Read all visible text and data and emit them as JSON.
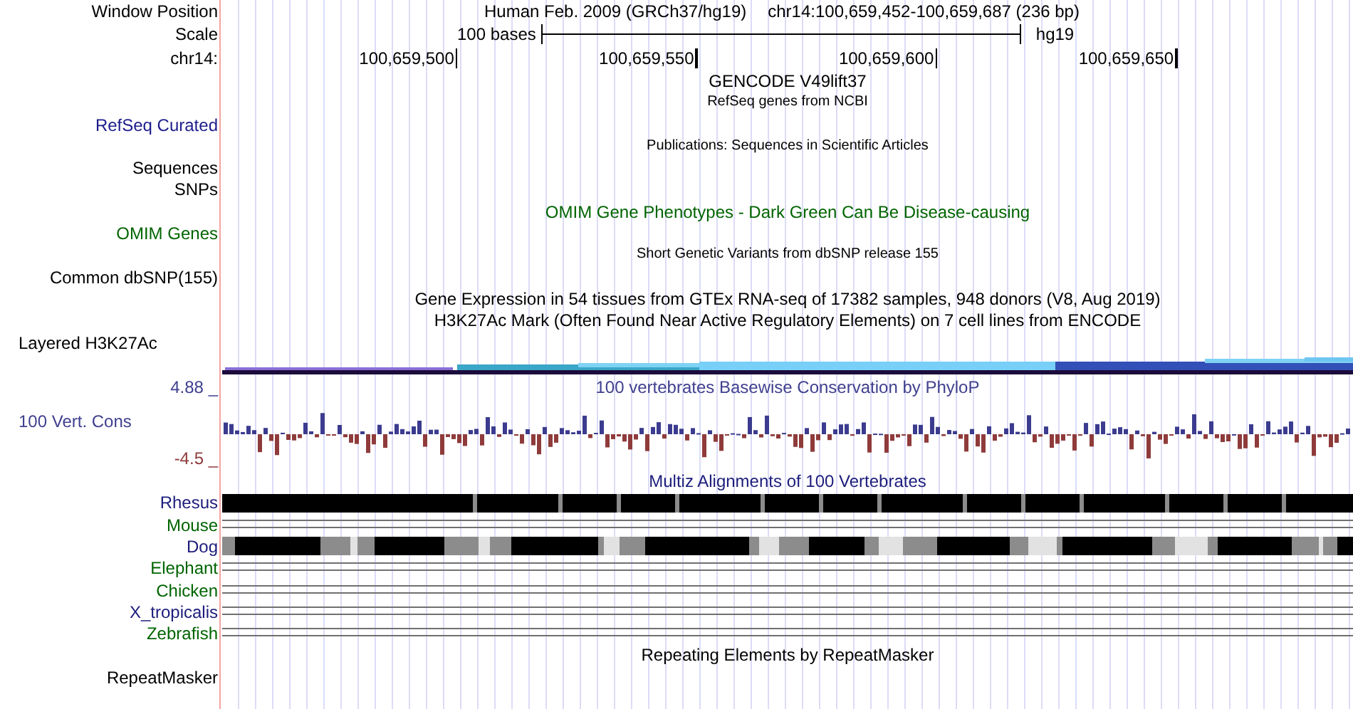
{
  "header": {
    "window_position_label": "Window Position",
    "assembly": "Human Feb. 2009 (GRCh37/hg19)",
    "position": "chr14:100,659,452-100,659,687 (236 bp)",
    "scale_label": "Scale",
    "scale_text": "100 bases",
    "scale_db": "hg19",
    "chrom_label": "chr14:",
    "ticks": [
      "100,659,500",
      "100,659,550",
      "100,659,600",
      "100,659,650"
    ]
  },
  "track_rows": [
    {
      "kind": "title",
      "title": "GENCODE V49lift37",
      "color": "#000000"
    },
    {
      "kind": "caption",
      "title": "RefSeq genes from NCBI",
      "color": "#000000"
    },
    {
      "kind": "label",
      "label": "RefSeq Curated",
      "color": "#1c1c8c"
    },
    {
      "kind": "caption",
      "title": "Publications: Sequences in Scientific Articles",
      "color": "#000000"
    },
    {
      "kind": "label",
      "label": "Sequences",
      "color": "#000000"
    },
    {
      "kind": "label",
      "label": "SNPs",
      "color": "#000000"
    },
    {
      "kind": "title",
      "title": "OMIM Gene Phenotypes - Dark Green Can Be Disease-causing",
      "color": "#006400"
    },
    {
      "kind": "label",
      "label": "OMIM Genes",
      "color": "#006400"
    },
    {
      "kind": "caption",
      "title": "Short Genetic Variants from dbSNP release 155",
      "color": "#000000"
    },
    {
      "kind": "label",
      "label": "Common dbSNP(155)",
      "color": "#000000"
    },
    {
      "kind": "title",
      "title": "Gene Expression in 54 tissues from GTEx RNA-seq of 17382 samples, 948 donors (V8, Aug 2019)",
      "color": "#000000"
    },
    {
      "kind": "title",
      "title": "H3K27Ac Mark (Often Found Near Active Regulatory Elements) on 7 cell lines from ENCODE",
      "color": "#000000"
    }
  ],
  "layered": {
    "label": "Layered H3K27Ac"
  },
  "conservation": {
    "max": "4.88 _",
    "title": "100 vertebrates Basewise Conservation by PhyloP",
    "label": "100 Vert. Cons",
    "min": "-4.5 _"
  },
  "multiz": {
    "title": "Multiz Alignments of 100 Vertebrates",
    "species": [
      {
        "name": "Rhesus",
        "color": "#1c1c7c",
        "kind": "solid"
      },
      {
        "name": "Mouse",
        "color": "#006400",
        "kind": "lines"
      },
      {
        "name": "Dog",
        "color": "#1c1c7c",
        "kind": "blocks"
      },
      {
        "name": "Elephant",
        "color": "#006400",
        "kind": "lines"
      },
      {
        "name": "Chicken",
        "color": "#006400",
        "kind": "lines"
      },
      {
        "name": "X_tropicalis",
        "color": "#1c1c7c",
        "kind": "lines"
      },
      {
        "name": "Zebrafish",
        "color": "#006400",
        "kind": "lines"
      }
    ]
  },
  "repeatmasker": {
    "title": "Repeating Elements by RepeatMasker",
    "label": "RepeatMasker"
  }
}
